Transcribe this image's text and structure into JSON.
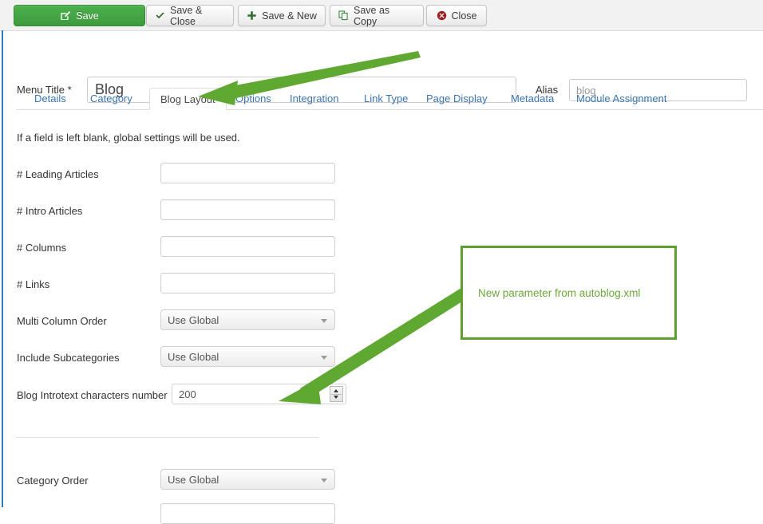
{
  "toolbar": {
    "buttons": [
      {
        "label": "Save",
        "icon": "edit-box-icon",
        "style": "primary"
      },
      {
        "label": "Save & Close",
        "icon": "check-icon",
        "style": "plain"
      },
      {
        "label": "Save & New",
        "icon": "plus-icon",
        "style": "plain"
      },
      {
        "label": "Save as Copy",
        "icon": "copy-pages-icon",
        "style": "plain"
      },
      {
        "label": "Close",
        "icon": "close-circle-icon",
        "style": "plain"
      }
    ]
  },
  "header": {
    "menu_title_label": "Menu Title *",
    "menu_title_value": "Blog",
    "alias_label": "Alias",
    "alias_value": "blog"
  },
  "tabs": {
    "items": [
      {
        "label": "Details",
        "active": false
      },
      {
        "label": "Category",
        "active": false
      },
      {
        "label": "Blog Layout",
        "active": true
      },
      {
        "label": "Options",
        "active": false
      },
      {
        "label": "Integration",
        "active": false
      },
      {
        "label": "Link Type",
        "active": false
      },
      {
        "label": "Page Display",
        "active": false
      },
      {
        "label": "Metadata",
        "active": false
      },
      {
        "label": "Module Assignment",
        "active": false
      }
    ]
  },
  "form": {
    "hint": "If a field is left blank, global settings will be used.",
    "fields": [
      {
        "label": "# Leading Articles",
        "type": "text",
        "value": ""
      },
      {
        "label": "# Intro Articles",
        "type": "text",
        "value": ""
      },
      {
        "label": "# Columns",
        "type": "text",
        "value": ""
      },
      {
        "label": "# Links",
        "type": "text",
        "value": ""
      },
      {
        "label": "Multi Column Order",
        "type": "select",
        "value": "Use Global"
      },
      {
        "label": "Include Subcategories",
        "type": "select",
        "value": "Use Global"
      },
      {
        "label": "Blog Introtext characters number",
        "type": "number",
        "value": "200"
      },
      {
        "label": "Category Order",
        "type": "select",
        "value": "Use Global"
      }
    ]
  },
  "annotations": {
    "callout_text": "New parameter from autoblog.xml",
    "arrow_color": "#5fa832",
    "callout_border_color": "#5da02e",
    "callout_text_color": "#6aa83a"
  }
}
